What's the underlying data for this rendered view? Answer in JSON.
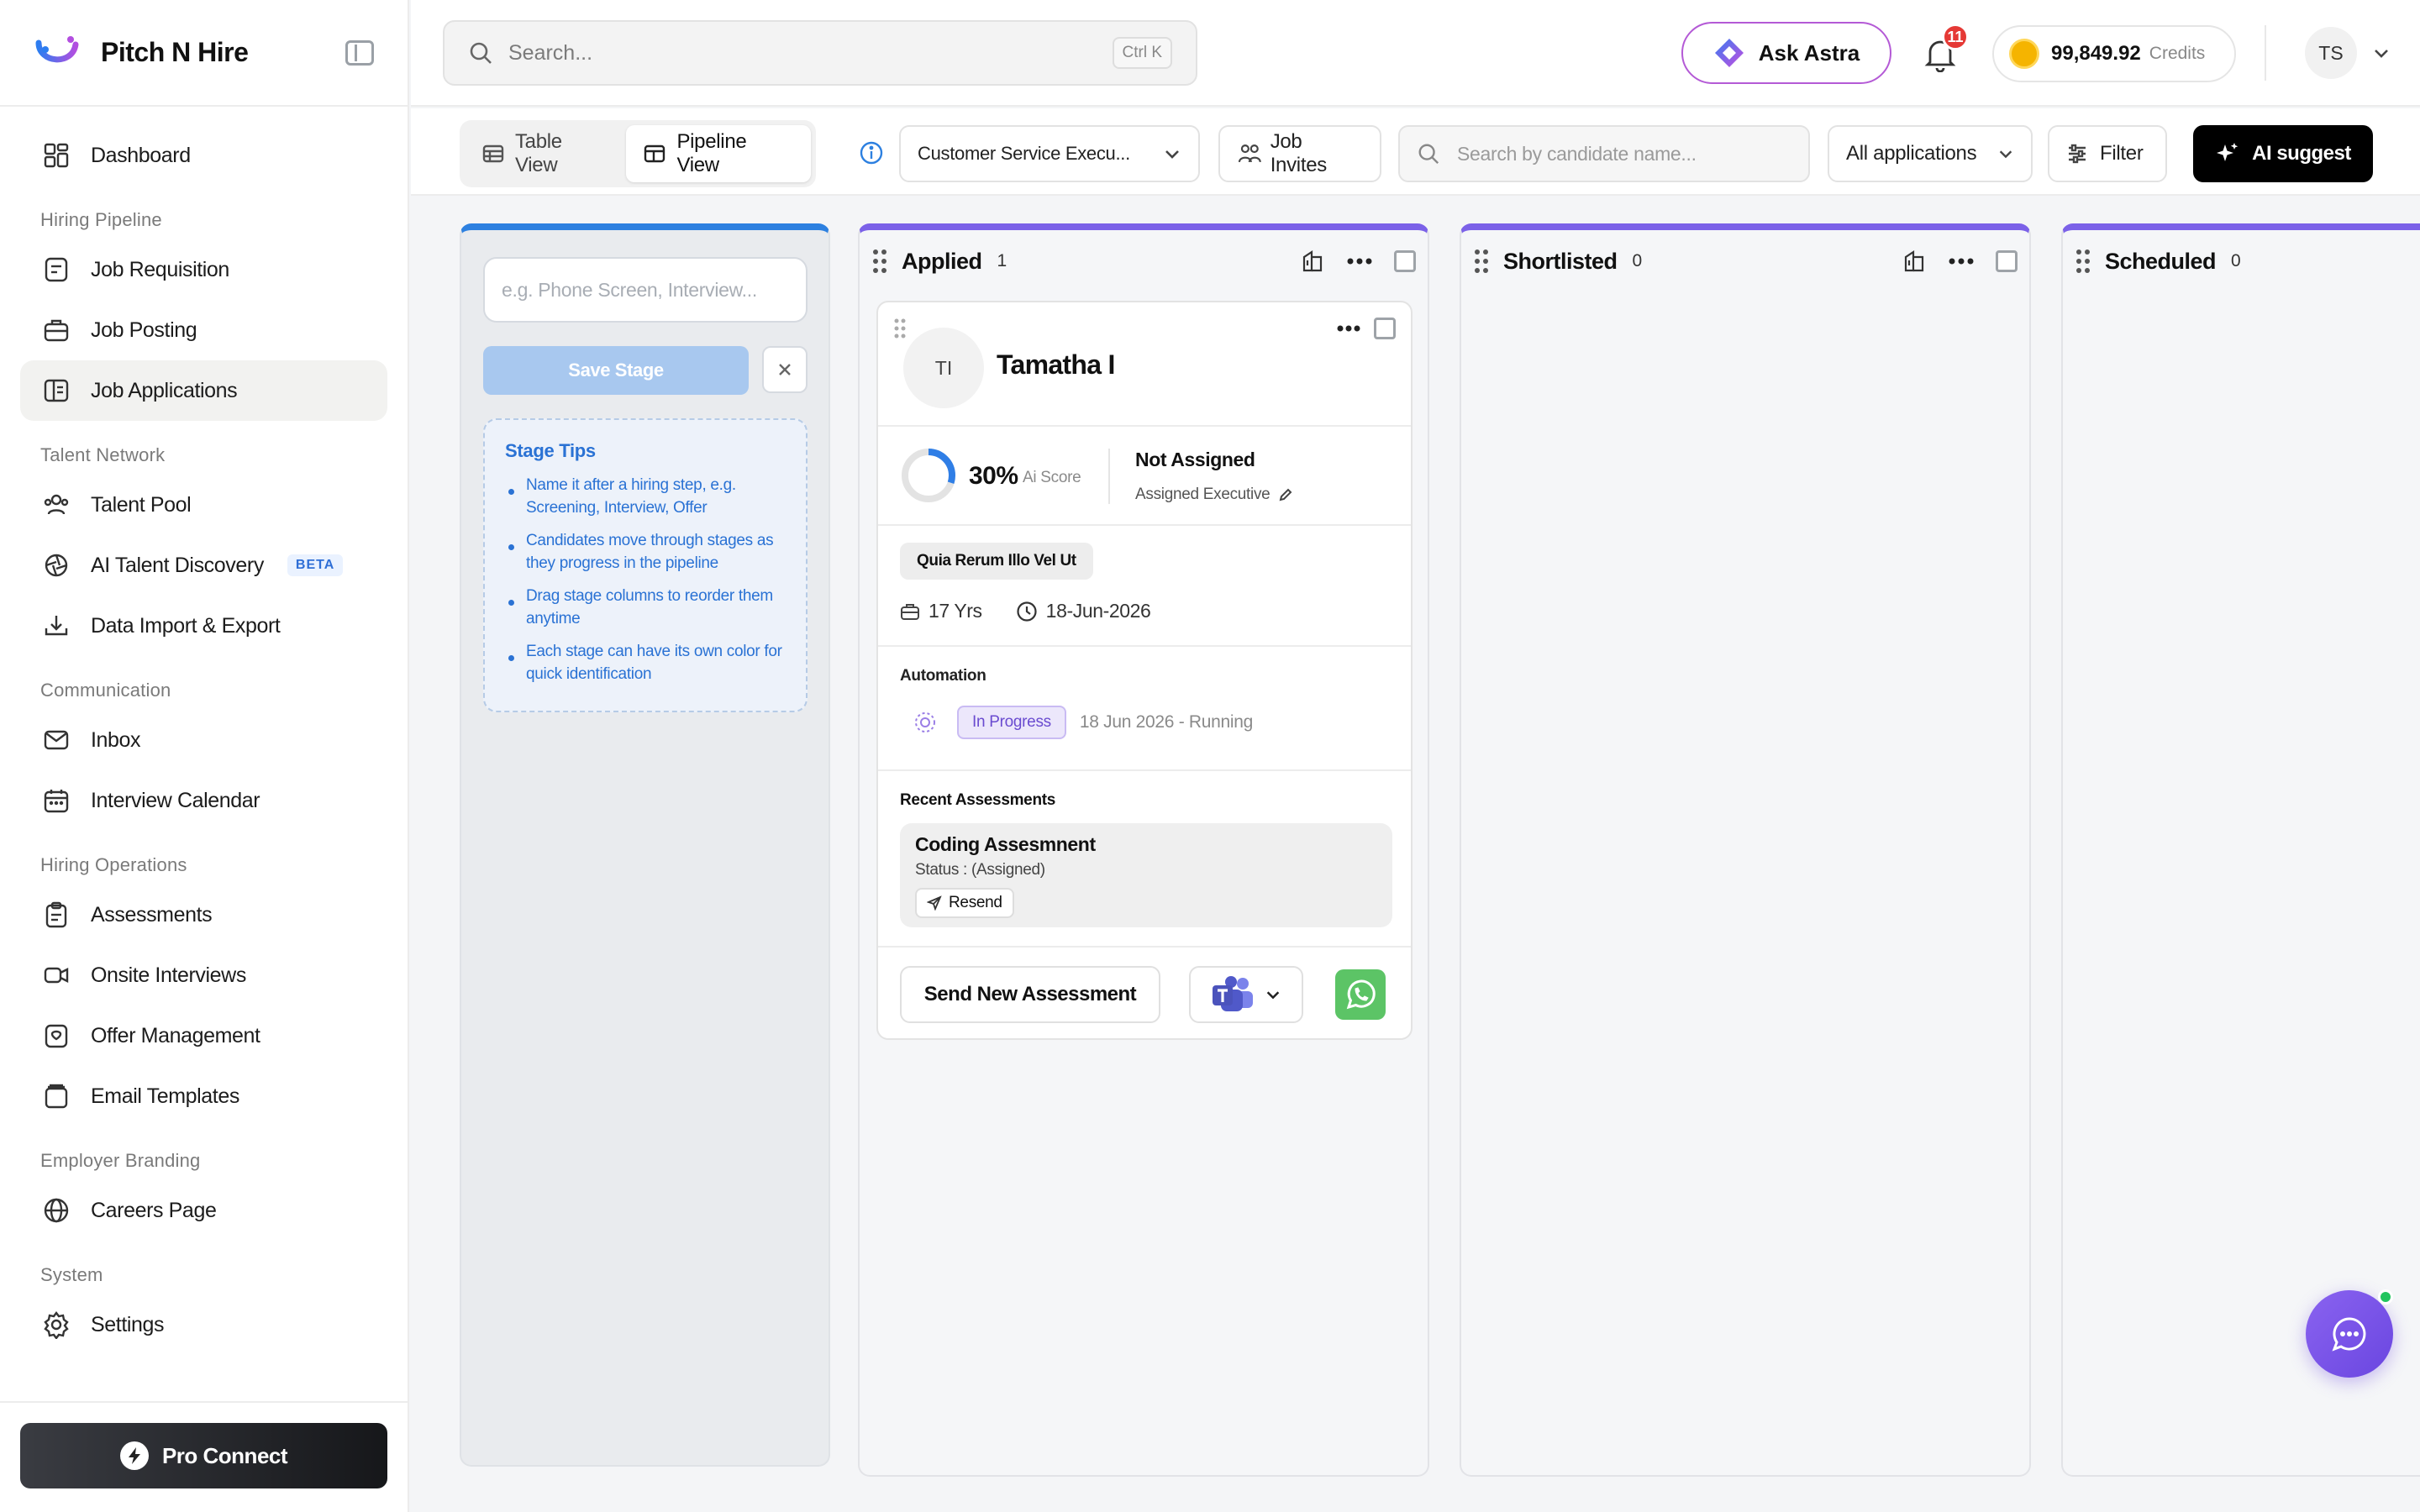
{
  "app": {
    "name": "Pitch N Hire"
  },
  "sidebar": {
    "items": [
      {
        "label": "Dashboard",
        "icon": "dashboard-icon"
      }
    ],
    "sections": [
      {
        "title": "Hiring Pipeline",
        "items": [
          {
            "label": "Job Requisition",
            "icon": "requisition-icon"
          },
          {
            "label": "Job Posting",
            "icon": "briefcase-icon"
          },
          {
            "label": "Job Applications",
            "icon": "applications-icon",
            "active": true
          }
        ]
      },
      {
        "title": "Talent Network",
        "items": [
          {
            "label": "Talent Pool",
            "icon": "users-icon"
          },
          {
            "label": "AI Talent Discovery",
            "icon": "aperture-icon",
            "badge": "BETA"
          },
          {
            "label": "Data Import & Export",
            "icon": "download-icon"
          }
        ]
      },
      {
        "title": "Communication",
        "items": [
          {
            "label": "Inbox",
            "icon": "mail-icon"
          },
          {
            "label": "Interview Calendar",
            "icon": "calendar-icon"
          }
        ]
      },
      {
        "title": "Hiring Operations",
        "items": [
          {
            "label": "Assessments",
            "icon": "clipboard-icon"
          },
          {
            "label": "Onsite Interviews",
            "icon": "video-icon"
          },
          {
            "label": "Offer Management",
            "icon": "offer-icon"
          },
          {
            "label": "Email Templates",
            "icon": "template-icon"
          }
        ]
      },
      {
        "title": "Employer Branding",
        "items": [
          {
            "label": "Careers Page",
            "icon": "globe-icon"
          }
        ]
      },
      {
        "title": "System",
        "items": [
          {
            "label": "Settings",
            "icon": "gear-icon"
          }
        ]
      }
    ],
    "footer_button": "Pro Connect"
  },
  "topbar": {
    "search_placeholder": "Search...",
    "search_shortcut": "Ctrl K",
    "ask_astra": "Ask Astra",
    "notification_count": "11",
    "credits_value": "99,849.92",
    "credits_label": "Credits",
    "user_initials": "TS"
  },
  "toolbar": {
    "table_view": "Table View",
    "pipeline_view": "Pipeline View",
    "job_select": "Customer Service Execu...",
    "job_invites": "Job Invites",
    "candidate_search_placeholder": "Search by candidate name...",
    "applications_filter": "All applications",
    "filter": "Filter",
    "ai_suggest": "AI suggest"
  },
  "new_stage": {
    "input_placeholder": "e.g. Phone Screen, Interview...",
    "save_label": "Save Stage",
    "tips_title": "Stage Tips",
    "tips": [
      "Name it after a hiring step, e.g. Screening, Interview, Offer",
      "Candidates move through stages as they progress in the pipeline",
      "Drag stage columns to reorder them anytime",
      "Each stage can have its own color for quick identification"
    ]
  },
  "columns": [
    {
      "title": "Applied",
      "count": "1"
    },
    {
      "title": "Shortlisted",
      "count": "0"
    },
    {
      "title": "Scheduled",
      "count": "0"
    }
  ],
  "candidate": {
    "initials": "TI",
    "name": "Tamatha I",
    "score": "30%",
    "score_fraction": 0.3,
    "score_label": "Ai Score",
    "assignee": "Not Assigned",
    "assignee_label": "Assigned Executive",
    "tag": "Quia Rerum Illo Vel Ut",
    "experience": "17 Yrs",
    "date": "18-Jun-2026",
    "automation_title": "Automation",
    "automation_status": "In Progress",
    "automation_detail": "18 Jun 2026  -  Running",
    "assessments_title": "Recent Assessments",
    "assessment_name": "Coding Assesmnent",
    "assessment_status": "Status : (Assigned)",
    "resend_label": "Resend",
    "send_assessment": "Send New Assessment"
  },
  "colors": {
    "accent_blue": "#2d80e0",
    "column_purple": "#7b61e8",
    "fab_purple": "#7c55ea",
    "whatsapp_green": "#5cc466"
  }
}
